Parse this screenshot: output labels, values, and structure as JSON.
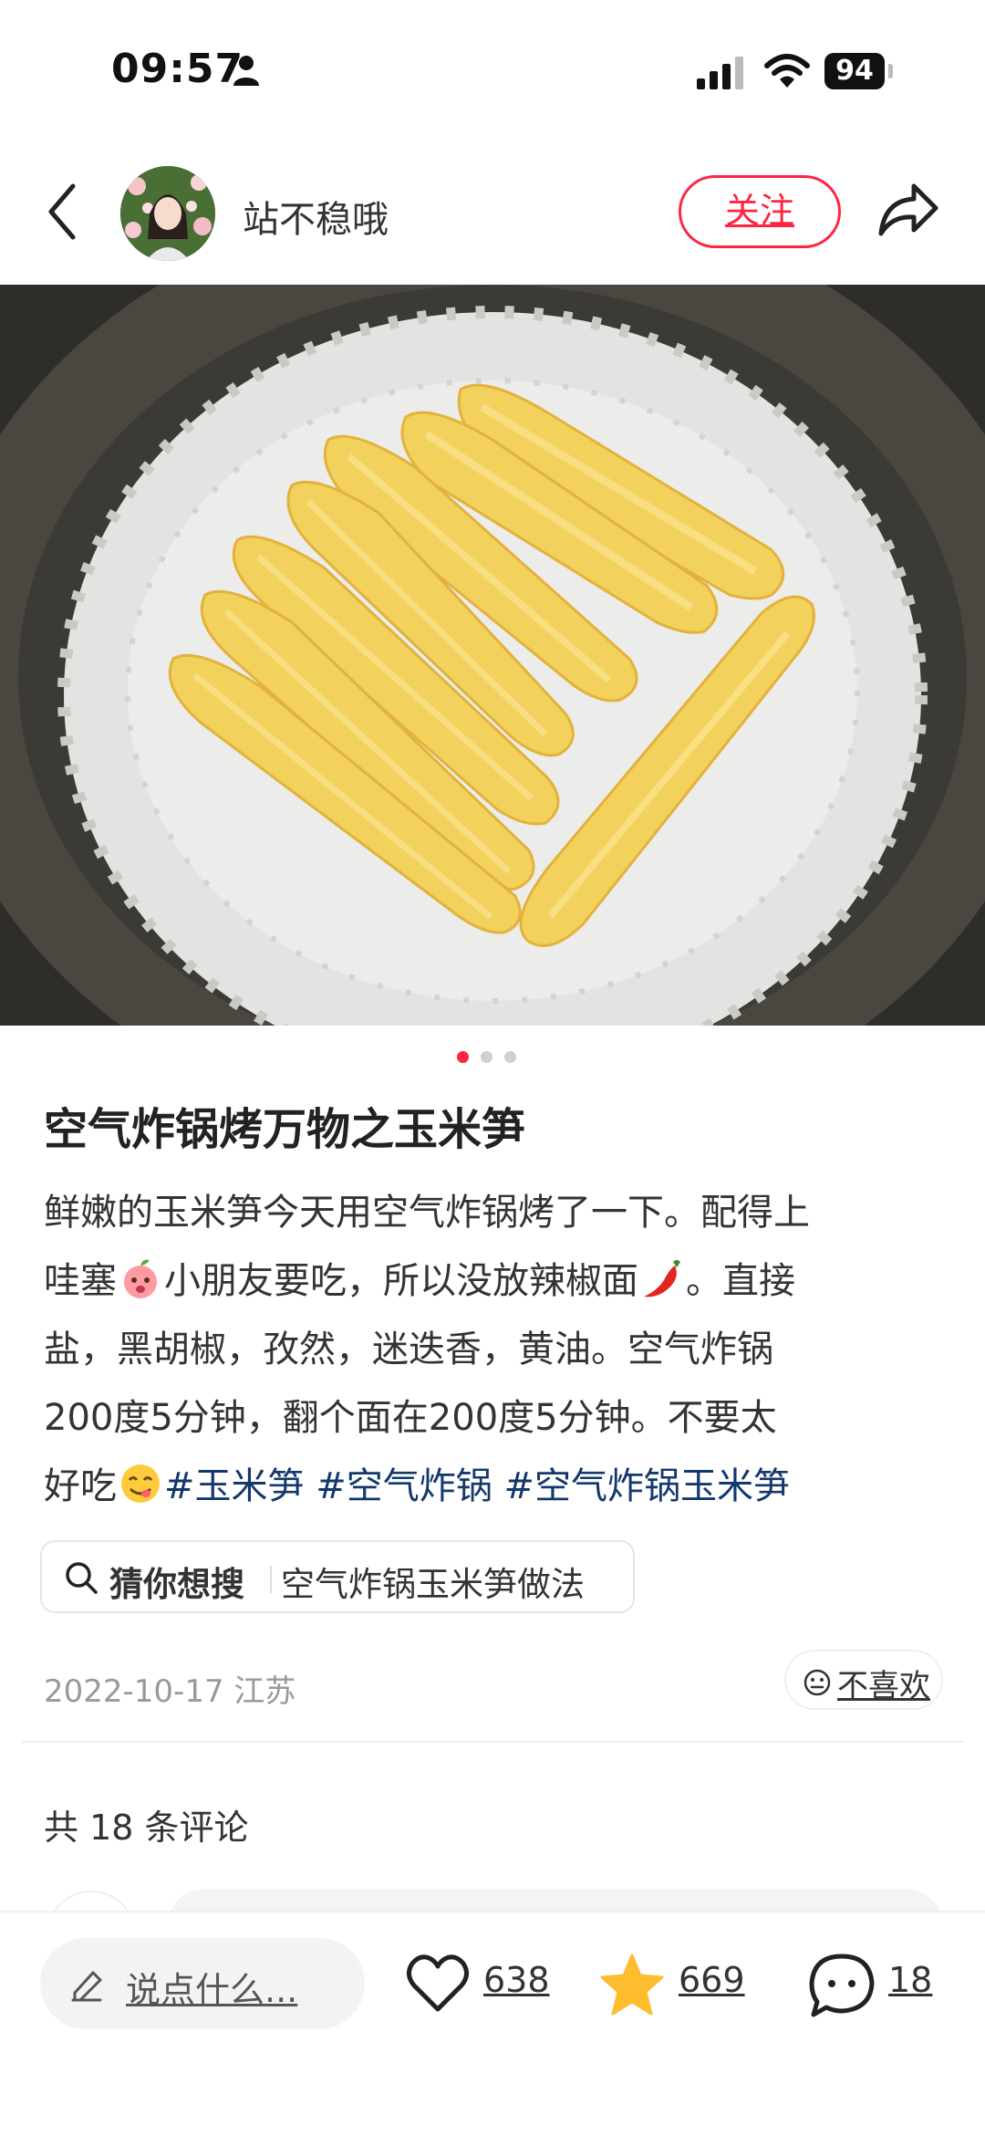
{
  "status_bar": {
    "time": "09:57",
    "battery": "94",
    "icons": [
      "person-icon",
      "signal-icon",
      "wifi-icon",
      "battery-icon"
    ]
  },
  "header": {
    "author_name": "站不稳哦",
    "follow_label": "关注",
    "icons": [
      "back-icon",
      "share-icon"
    ]
  },
  "carousel": {
    "total": 3,
    "active": 1
  },
  "post": {
    "title": "空气炸锅烤万物之玉米笋",
    "line1": "鲜嫩的玉米笋今天用空气炸锅烤了一下。配得上",
    "line2a": "哇塞",
    "line2b": "小朋友要吃，所以没放辣椒面",
    "line2c": "。直接",
    "line3": "盐，黑胡椒，孜然，迷迭香，黄油。空气炸锅",
    "line4": " 200度5分钟，翻个面在200度5分钟。不要太",
    "line5a": "好吃",
    "tags": [
      "#玉米笋",
      "#空气炸锅",
      "#空气炸锅玉米笋"
    ],
    "emojis": [
      "peach-emoji",
      "chili-emoji",
      "yum-emoji"
    ]
  },
  "search_suggest": {
    "label": "猜你想搜",
    "query": "空气炸锅玉米笋做法"
  },
  "meta": {
    "date_location": "2022-10-17 江苏",
    "dislike_label": "不喜欢"
  },
  "comments": {
    "count_label": "共 18 条评论"
  },
  "bottom_bar": {
    "placeholder": "说点什么...",
    "likes": "638",
    "stars": "669",
    "comments": "18"
  },
  "colors": {
    "accent": "#ff2442",
    "tag": "#13386c",
    "star": "#fdbd2f"
  }
}
